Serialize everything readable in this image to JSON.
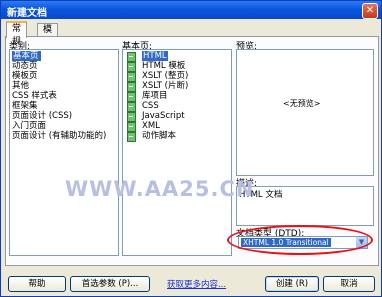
{
  "window": {
    "title": "新建文档",
    "close_symbol": "✕"
  },
  "tabs": [
    {
      "label": "常规",
      "active": true
    },
    {
      "label": "模板",
      "active": false
    }
  ],
  "category": {
    "label": "类别:",
    "items": [
      "基本页",
      "动态页",
      "模板页",
      "其他",
      "CSS 样式表",
      "框架集",
      "页面设计 (CSS)",
      "入门页面",
      "页面设计 (有辅助功能的)"
    ],
    "selected_index": 0
  },
  "basic_pages": {
    "label": "基本页:",
    "items": [
      "HTML",
      "HTML 模板",
      "XSLT (整页)",
      "XSLT (片断)",
      "库项目",
      "CSS",
      "JavaScript",
      "XML",
      "动作脚本"
    ],
    "selected_index": 0
  },
  "preview": {
    "label": "预览:",
    "no_preview": "<无预览>"
  },
  "description": {
    "label": "描述:",
    "text": "HTML 文档"
  },
  "doctype": {
    "label": "文档类型 (DTD):",
    "value": "XHTML 1.0 Transitional"
  },
  "watermark": "WWW.AA25.CN",
  "footer": {
    "help_label": "帮助",
    "prefs_label": "首选参数 (P)...",
    "more_link": "获取更多内容...",
    "create_label": "创建 (R)",
    "cancel_label": "取消"
  },
  "colors": {
    "title_bar": "#0a56df",
    "selection": "#316ac5",
    "highlight_ellipse": "#ee1010",
    "link": "#1a31d8"
  }
}
